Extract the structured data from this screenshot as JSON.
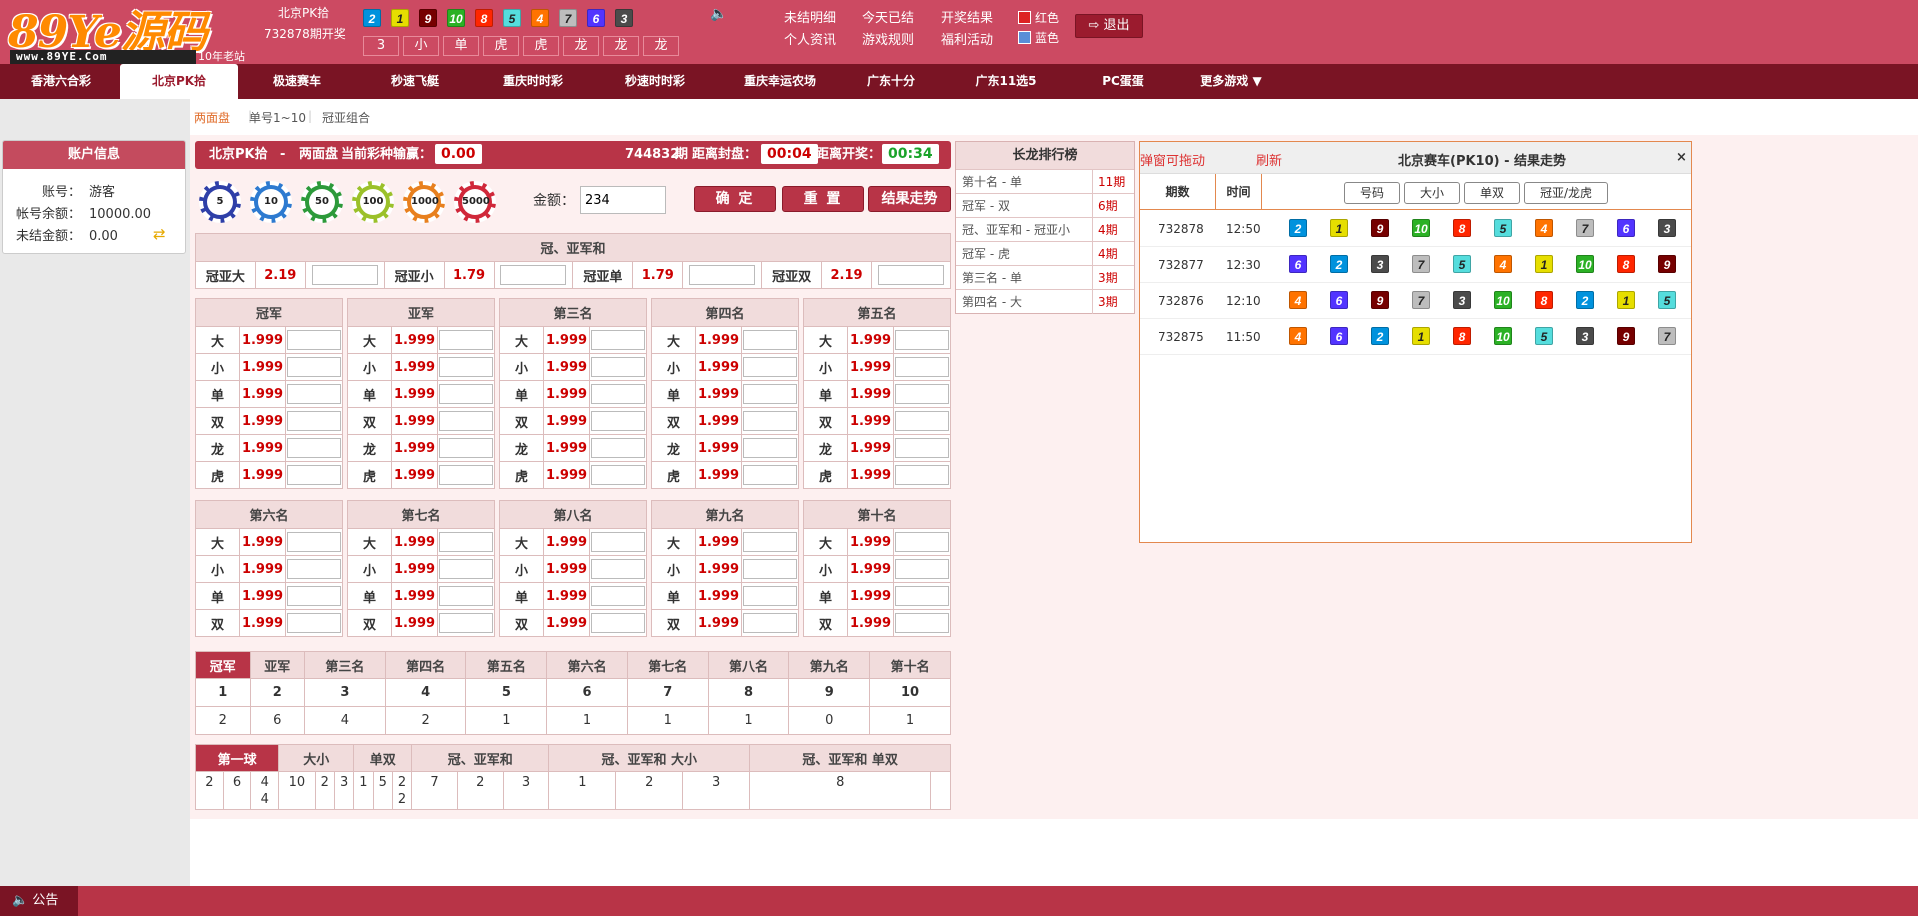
{
  "header": {
    "logo_text": "89Ye源码",
    "logo_url": "www.89YE.Com",
    "logo_slogan": "10年老站",
    "game_name": "北京PK拾",
    "period_text": "732878期开奖",
    "last_balls": [
      2,
      1,
      9,
      10,
      8,
      5,
      4,
      7,
      6,
      3
    ],
    "last_stats": [
      "3",
      "小",
      "单",
      "虎",
      "虎",
      "龙",
      "龙",
      "龙"
    ],
    "links_col1": [
      "未结明细",
      "个人资讯"
    ],
    "links_col2": [
      "今天已结",
      "游戏规则"
    ],
    "links_col3": [
      "开奖结果",
      "福利活动"
    ],
    "color_red": "红色",
    "color_blue": "蓝色",
    "logout": "退出"
  },
  "nav": [
    "香港六合彩",
    "北京PK拾",
    "极速赛车",
    "秒速飞艇",
    "重庆时时彩",
    "秒速时时彩",
    "重庆幸运农场",
    "广东十分",
    "广东11选5",
    "PC蛋蛋",
    "更多游戏 ▼"
  ],
  "subtabs": [
    "两面盘",
    "单号1~10",
    "冠亚组合"
  ],
  "account": {
    "title": "账户信息",
    "rows": [
      {
        "k": "账号：",
        "v": "游客"
      },
      {
        "k": "帐号余额：",
        "v": "10000.00"
      },
      {
        "k": "未结金额：",
        "v": "0.00"
      }
    ]
  },
  "bet_header": {
    "game": "北京PK拾",
    "sep": "-",
    "mode": "两面盘",
    "winloss_label": "当前彩种输赢：",
    "winloss": "0.00",
    "period": "744832",
    "period_suffix": "期",
    "close_label": "距离封盘：",
    "close_time": "00:04",
    "open_label": "距离开奖：",
    "open_time": "00:34"
  },
  "chips": [
    "5",
    "10",
    "50",
    "100",
    "1000",
    "5000"
  ],
  "amount_label": "金额：",
  "amount_value": "234",
  "buttons": {
    "confirm": "确 定",
    "reset": "重 置",
    "trend": "结果走势"
  },
  "gyh": {
    "title": "冠、亚军和",
    "items": [
      {
        "label": "冠亚大",
        "odds": "2.19"
      },
      {
        "label": "冠亚小",
        "odds": "1.79"
      },
      {
        "label": "冠亚单",
        "odds": "1.79"
      },
      {
        "label": "冠亚双",
        "odds": "2.19"
      }
    ]
  },
  "ranks_top": [
    {
      "title": "冠军"
    },
    {
      "title": "亚军"
    },
    {
      "title": "第三名"
    },
    {
      "title": "第四名"
    },
    {
      "title": "第五名"
    }
  ],
  "rows_top": [
    {
      "label": "大",
      "odds": "1.999"
    },
    {
      "label": "小",
      "odds": "1.999"
    },
    {
      "label": "单",
      "odds": "1.999"
    },
    {
      "label": "双",
      "odds": "1.999"
    },
    {
      "label": "龙",
      "odds": "1.999"
    },
    {
      "label": "虎",
      "odds": "1.999"
    }
  ],
  "ranks_bottom": [
    {
      "title": "第六名"
    },
    {
      "title": "第七名"
    },
    {
      "title": "第八名"
    },
    {
      "title": "第九名"
    },
    {
      "title": "第十名"
    }
  ],
  "rows_bottom": [
    {
      "label": "大",
      "odds": "1.999"
    },
    {
      "label": "小",
      "odds": "1.999"
    },
    {
      "label": "单",
      "odds": "1.999"
    },
    {
      "label": "双",
      "odds": "1.999"
    }
  ],
  "pos_stat": {
    "headers": [
      "冠军",
      "亚军",
      "第三名",
      "第四名",
      "第五名",
      "第六名",
      "第七名",
      "第八名",
      "第九名",
      "第十名"
    ],
    "nums": [
      "1",
      "2",
      "3",
      "4",
      "5",
      "6",
      "7",
      "8",
      "9",
      "10"
    ],
    "counts": [
      "2",
      "6",
      "4",
      "2",
      "1",
      "1",
      "1",
      "1",
      "0",
      "1"
    ]
  },
  "ball_stat": {
    "tabs": [
      "第一球",
      "大小",
      "单双",
      "冠、亚军和",
      "冠、亚军和 大小",
      "冠、亚军和 单双"
    ],
    "values": [
      "2",
      "6",
      "4\n4",
      "10",
      "2",
      "3",
      "1",
      "5",
      "2\n2",
      "7",
      "2",
      "3",
      "1",
      "2",
      "3",
      "8",
      ""
    ]
  },
  "long_dragon": {
    "title": "长龙排行榜",
    "rows": [
      {
        "name": "第十名 - 单",
        "periods": "11期"
      },
      {
        "name": "冠军 - 双",
        "periods": "6期"
      },
      {
        "name": "冠、亚军和 - 冠亚小",
        "periods": "4期"
      },
      {
        "name": "冠军 - 虎",
        "periods": "4期"
      },
      {
        "name": "第三名 - 单",
        "periods": "3期"
      },
      {
        "name": "第四名 - 大",
        "periods": "3期"
      }
    ]
  },
  "trend": {
    "drag_label": "弹窗可拖动",
    "refresh_label": "刷新",
    "title": "北京赛车(PK10) - 结果走势",
    "close": "×",
    "col_period": "期数",
    "col_time": "时间",
    "tabs": [
      "号码",
      "大小",
      "单双",
      "冠亚/龙虎"
    ],
    "rows": [
      {
        "period": "732878",
        "time": "12:50",
        "balls": [
          2,
          1,
          9,
          10,
          8,
          5,
          4,
          7,
          6,
          3
        ]
      },
      {
        "period": "732877",
        "time": "12:30",
        "balls": [
          6,
          2,
          3,
          7,
          5,
          4,
          1,
          10,
          8,
          9
        ]
      },
      {
        "period": "732876",
        "time": "12:10",
        "balls": [
          4,
          6,
          9,
          7,
          3,
          10,
          8,
          2,
          1,
          5
        ]
      },
      {
        "period": "732875",
        "time": "11:50",
        "balls": [
          4,
          6,
          2,
          1,
          8,
          10,
          5,
          3,
          9,
          7
        ]
      }
    ]
  },
  "footer": {
    "notice": "公告"
  }
}
